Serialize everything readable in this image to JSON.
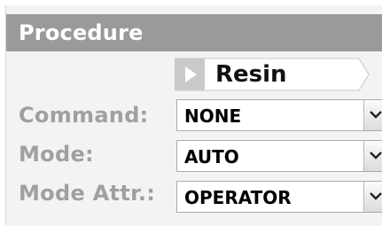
{
  "header": {
    "title": "Procedure"
  },
  "tab": {
    "label": "Resin",
    "icon": "play-arrow-icon"
  },
  "fields": [
    {
      "label": "Command:",
      "value": "NONE"
    },
    {
      "label": "Mode:",
      "value": "AUTO"
    },
    {
      "label": "Mode Attr.:",
      "value": "OPERATOR"
    }
  ],
  "colors": {
    "header_bg": "#9a9a9a",
    "panel_bg": "#f3f3f3",
    "label_text": "#a0a0a0"
  }
}
